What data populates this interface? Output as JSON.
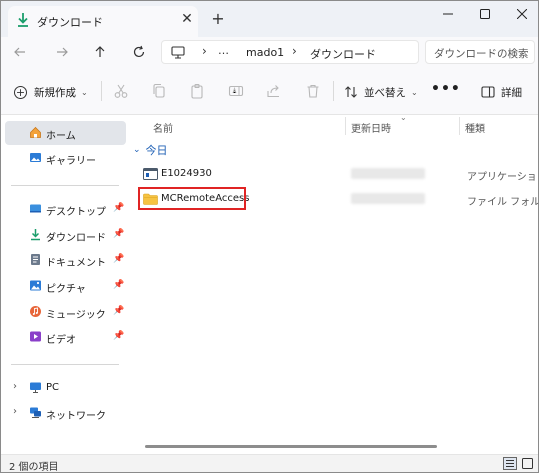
{
  "window": {
    "tab_title": "ダウンロード",
    "tab_close": "✕",
    "tab_add": "+"
  },
  "address": {
    "more": "…",
    "segments": [
      "mado1",
      "ダウンロード"
    ],
    "separator": "›",
    "search_placeholder": "ダウンロードの検索"
  },
  "toolbar": {
    "new_label": "新規作成",
    "new_caret": "⌄",
    "sort_label": "並べ替え",
    "sort_caret": "⌄",
    "more_label": "•••",
    "details_label": "詳細"
  },
  "sidebar": {
    "items": [
      {
        "label": "ホーム",
        "icon": "home-icon",
        "selected": true
      },
      {
        "label": "ギャラリー",
        "icon": "gallery-icon"
      },
      {
        "label": "デスクトップ",
        "icon": "desktop-icon",
        "pinned": true
      },
      {
        "label": "ダウンロード",
        "icon": "download-icon",
        "pinned": true
      },
      {
        "label": "ドキュメント",
        "icon": "documents-icon",
        "pinned": true
      },
      {
        "label": "ピクチャ",
        "icon": "pictures-icon",
        "pinned": true
      },
      {
        "label": "ミュージック",
        "icon": "music-icon",
        "pinned": true
      },
      {
        "label": "ビデオ",
        "icon": "videos-icon",
        "pinned": true
      },
      {
        "label": "PC",
        "icon": "pc-icon",
        "expandable": true
      },
      {
        "label": "ネットワーク",
        "icon": "network-icon",
        "expandable": true
      }
    ]
  },
  "content": {
    "columns": [
      "名前",
      "更新日時",
      "種類"
    ],
    "group_label": "今日",
    "files": [
      {
        "name": "E1024930",
        "type": "アプリケーション",
        "icon": "application-icon"
      },
      {
        "name": "MCRemoteAccess",
        "type": "ファイル フォルダー",
        "icon": "folder-icon",
        "highlighted": true
      }
    ]
  },
  "status": {
    "item_count": "2 個の項目"
  },
  "colors": {
    "accent": "#1d5fb5",
    "highlight": "#e02424",
    "folder": "#f6c342",
    "selection": "#e2e5ea"
  }
}
